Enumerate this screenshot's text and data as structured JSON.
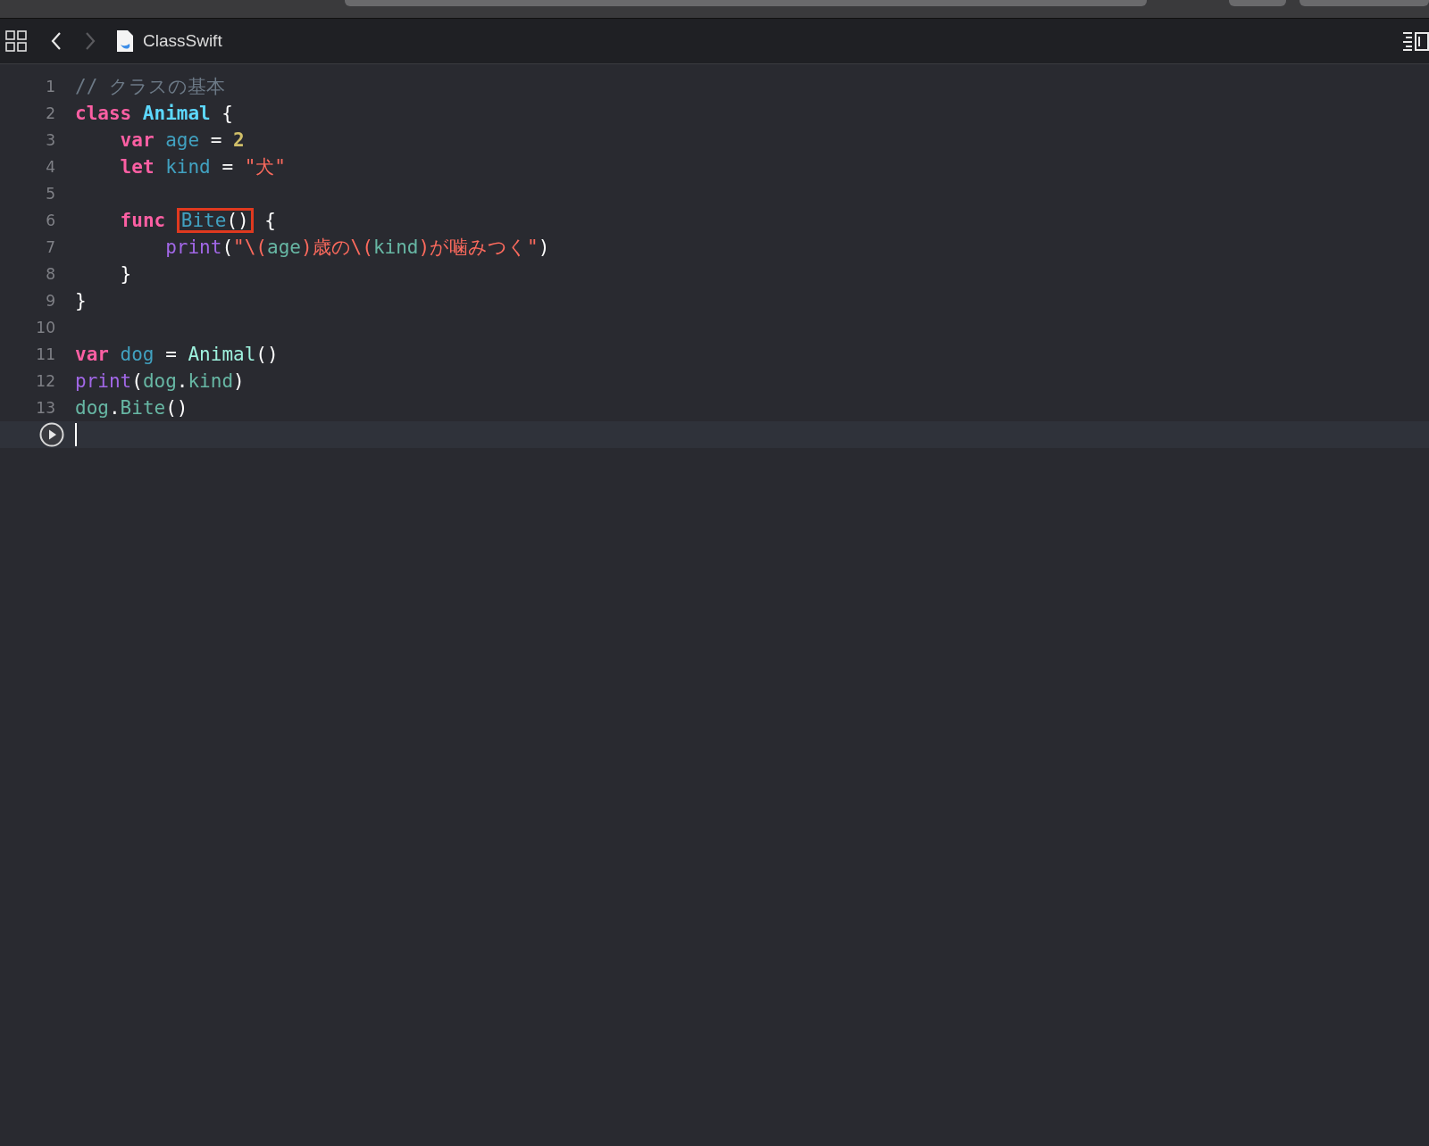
{
  "jump_bar": {
    "back": {
      "disabled": false
    },
    "forward": {
      "disabled": true
    },
    "file": "ClassSwift"
  },
  "lines": [
    {
      "number": "1",
      "selected": false,
      "tokens": [
        {
          "kind": "comment",
          "text": "// クラスの基本"
        }
      ]
    },
    {
      "number": "2",
      "selected": false,
      "tokens": [
        {
          "kind": "keyword",
          "text": "class "
        },
        {
          "kind": "type_decl",
          "text": "Animal"
        },
        {
          "kind": "plain",
          "text": " {"
        }
      ],
      "children": [
        {
          "number": "3",
          "selected": false,
          "tokens": [
            {
              "kind": "keyword",
              "text": "var "
            },
            {
              "kind": "decl",
              "text": "age"
            },
            {
              "kind": "plain",
              "text": " = "
            },
            {
              "kind": "number",
              "text": "2"
            }
          ]
        },
        {
          "number": "4",
          "selected": false,
          "tokens": [
            {
              "kind": "keyword",
              "text": "let "
            },
            {
              "kind": "decl",
              "text": "kind"
            },
            {
              "kind": "plain",
              "text": " = "
            },
            {
              "kind": "string",
              "text": "\"犬\""
            }
          ]
        },
        {
          "number": "5",
          "selected": false
        },
        {
          "number": "6",
          "selected": false,
          "tokens": [
            {
              "kind": "keyword",
              "text": "func "
            },
            {
              "kind": "group",
              "boxed": true,
              "tokens": [
                {
                  "kind": "decl",
                  "text": "Bite"
                },
                {
                  "kind": "plain",
                  "text": "()"
                }
              ]
            },
            {
              "kind": "plain",
              "text": " {"
            }
          ],
          "children": [
            {
              "number": "7",
              "selected": false,
              "tokens": [
                {
                  "kind": "builtin",
                  "text": "print"
                },
                {
                  "kind": "plain",
                  "text": "("
                },
                {
                  "kind": "string",
                  "text": "\"\\("
                },
                {
                  "kind": "ref",
                  "text": "age"
                },
                {
                  "kind": "string",
                  "text": ")歳の\\("
                },
                {
                  "kind": "ref",
                  "text": "kind"
                },
                {
                  "kind": "string",
                  "text": ")が噛みつく\""
                },
                {
                  "kind": "plain",
                  "text": ")"
                }
              ]
            }
          ]
        },
        {
          "number": "8",
          "selected": false,
          "tokens": [
            {
              "kind": "plain",
              "text": "}"
            }
          ]
        }
      ]
    },
    {
      "number": "9",
      "selected": false,
      "tokens": [
        {
          "kind": "plain",
          "text": "}"
        }
      ]
    },
    {
      "number": "10",
      "selected": false
    },
    {
      "number": "11",
      "selected": false,
      "tokens": [
        {
          "kind": "keyword",
          "text": "var "
        },
        {
          "kind": "decl",
          "text": "dog"
        },
        {
          "kind": "plain",
          "text": " = "
        },
        {
          "kind": "type_ref",
          "text": "Animal"
        },
        {
          "kind": "plain",
          "text": "()"
        }
      ]
    },
    {
      "number": "12",
      "selected": false,
      "tokens": [
        {
          "kind": "builtin",
          "text": "print"
        },
        {
          "kind": "plain",
          "text": "("
        },
        {
          "kind": "ref",
          "text": "dog"
        },
        {
          "kind": "plain",
          "text": "."
        },
        {
          "kind": "ref",
          "text": "kind"
        },
        {
          "kind": "plain",
          "text": ")"
        }
      ]
    },
    {
      "number": "13",
      "selected": false,
      "tokens": [
        {
          "kind": "ref",
          "text": "dog"
        },
        {
          "kind": "plain",
          "text": "."
        },
        {
          "kind": "ref",
          "text": "Bite"
        },
        {
          "kind": "plain",
          "text": "()"
        }
      ]
    },
    {
      "selected": true
    }
  ]
}
